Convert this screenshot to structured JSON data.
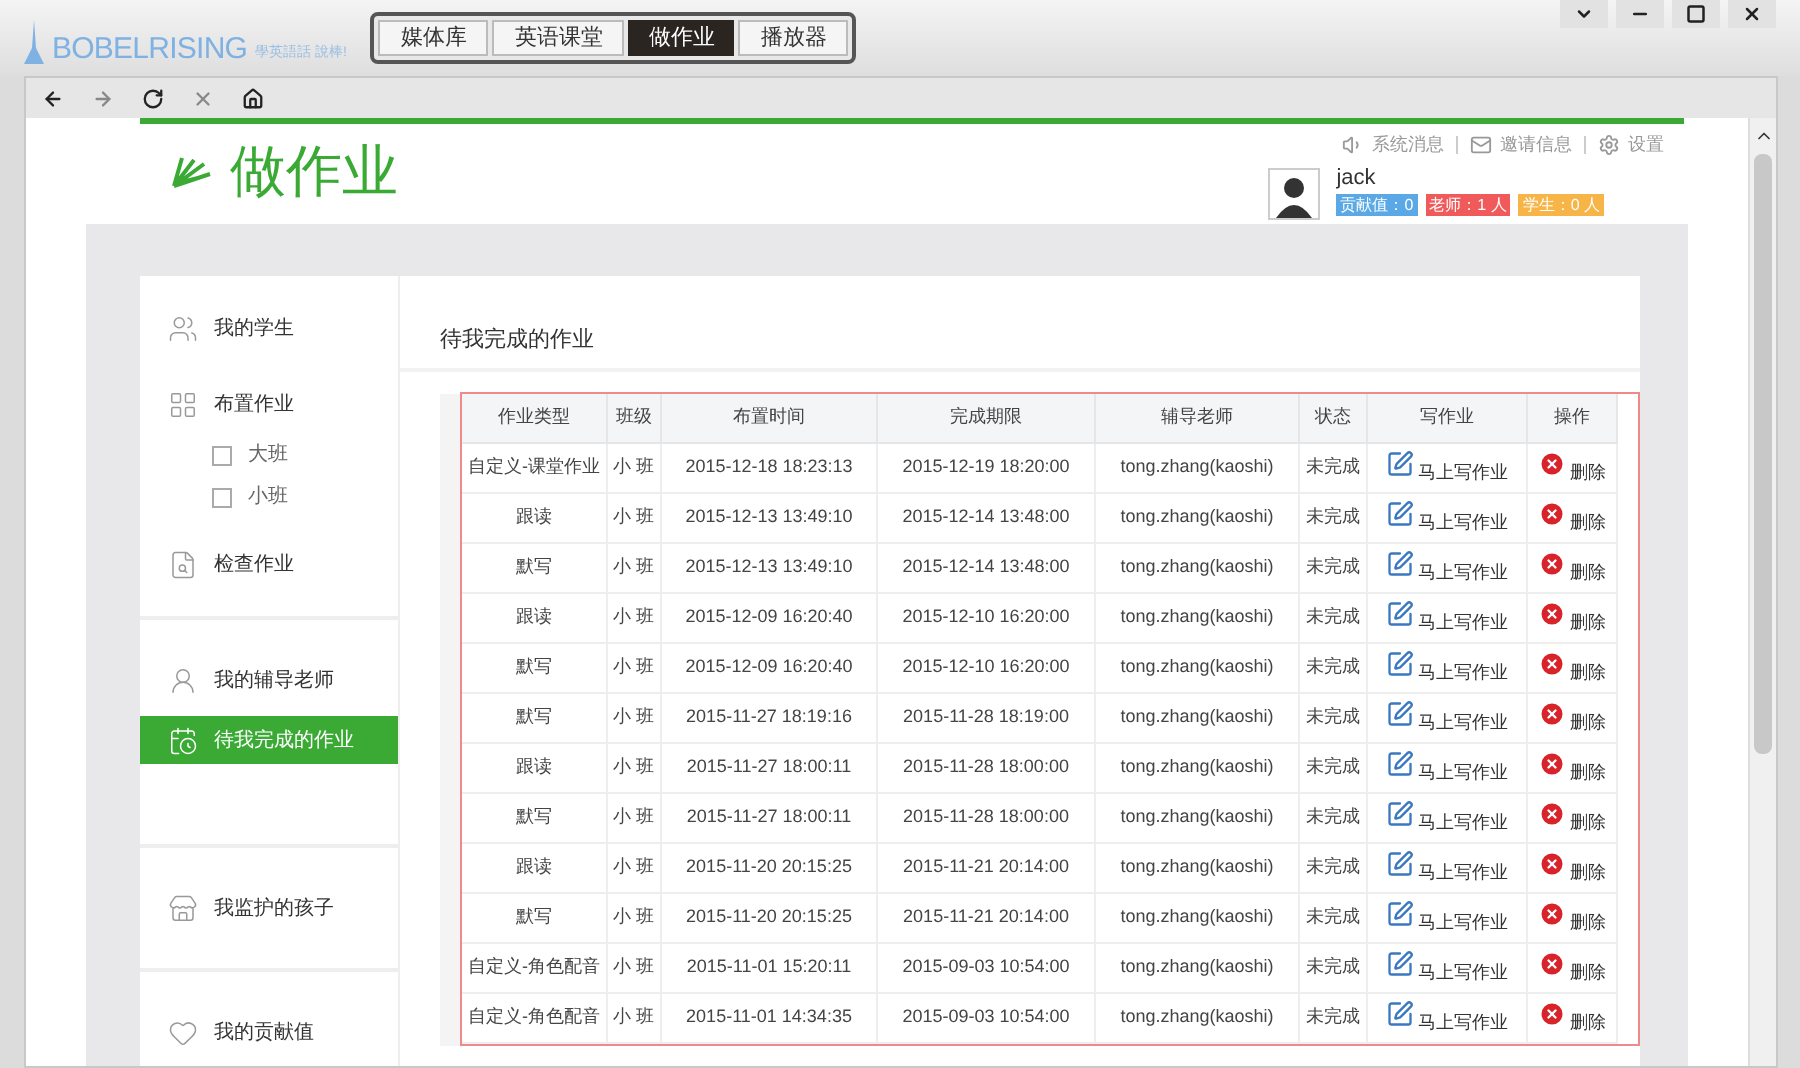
{
  "app": {
    "logo": "BOBELRISING",
    "slogan": "學英語話 說棒!",
    "tabs": [
      {
        "label": "媒体库",
        "selected": false
      },
      {
        "label": "英语课堂",
        "selected": false
      },
      {
        "label": "做作业",
        "selected": true
      },
      {
        "label": "播放器",
        "selected": false
      }
    ]
  },
  "page_title": "做作业",
  "header_links": [
    {
      "kind": "sound",
      "label": "系统消息"
    },
    {
      "kind": "mail",
      "label": "邀请信息"
    },
    {
      "kind": "gear",
      "label": "设置"
    }
  ],
  "user": {
    "name": "jack",
    "badges": [
      {
        "label": "贡献值：0",
        "color": "#5aa9e6"
      },
      {
        "label": "老师：1 人",
        "color": "#f05a5a"
      },
      {
        "label": "学生：0 人",
        "color": "#f7b548"
      }
    ]
  },
  "sidebar": [
    [
      {
        "kind": "users",
        "label": "我的学生",
        "selected": false
      },
      {
        "kind": "grid",
        "label": "布置作业",
        "selected": false,
        "children": [
          {
            "label": "大班",
            "selected": false
          },
          {
            "label": "小班",
            "selected": false
          }
        ]
      },
      {
        "kind": "doc",
        "label": "检查作业",
        "selected": false
      }
    ],
    [
      {
        "kind": "teacher",
        "label": "我的辅导老师",
        "selected": false
      },
      {
        "kind": "calendar",
        "label": "待我完成的作业",
        "selected": true
      }
    ],
    [
      {
        "kind": "shop",
        "label": "我监护的孩子",
        "selected": false
      }
    ],
    [
      {
        "kind": "heart",
        "label": "我的贡献值",
        "selected": false
      }
    ]
  ],
  "section_title": "待我完成的作业",
  "table": {
    "columns": [
      "作业类型",
      "班级",
      "布置时间",
      "完成期限",
      "辅导老师",
      "状态",
      "写作业",
      "操作"
    ],
    "rows": [
      [
        "自定义-课堂作业",
        "小 班",
        "2015-12-18 18:23:13",
        "2015-12-19 18:20:00",
        "tong.zhang(kaoshi)",
        "未完成",
        "马上写作业",
        "删除"
      ],
      [
        "跟读",
        "小 班",
        "2015-12-13 13:49:10",
        "2015-12-14 13:48:00",
        "tong.zhang(kaoshi)",
        "未完成",
        "马上写作业",
        "删除"
      ],
      [
        "默写",
        "小 班",
        "2015-12-13 13:49:10",
        "2015-12-14 13:48:00",
        "tong.zhang(kaoshi)",
        "未完成",
        "马上写作业",
        "删除"
      ],
      [
        "跟读",
        "小 班",
        "2015-12-09 16:20:40",
        "2015-12-10 16:20:00",
        "tong.zhang(kaoshi)",
        "未完成",
        "马上写作业",
        "删除"
      ],
      [
        "默写",
        "小 班",
        "2015-12-09 16:20:40",
        "2015-12-10 16:20:00",
        "tong.zhang(kaoshi)",
        "未完成",
        "马上写作业",
        "删除"
      ],
      [
        "默写",
        "小 班",
        "2015-11-27 18:19:16",
        "2015-11-28 18:19:00",
        "tong.zhang(kaoshi)",
        "未完成",
        "马上写作业",
        "删除"
      ],
      [
        "跟读",
        "小 班",
        "2015-11-27 18:00:11",
        "2015-11-28 18:00:00",
        "tong.zhang(kaoshi)",
        "未完成",
        "马上写作业",
        "删除"
      ],
      [
        "默写",
        "小 班",
        "2015-11-27 18:00:11",
        "2015-11-28 18:00:00",
        "tong.zhang(kaoshi)",
        "未完成",
        "马上写作业",
        "删除"
      ],
      [
        "跟读",
        "小 班",
        "2015-11-20 20:15:25",
        "2015-11-21 20:14:00",
        "tong.zhang(kaoshi)",
        "未完成",
        "马上写作业",
        "删除"
      ],
      [
        "默写",
        "小 班",
        "2015-11-20 20:15:25",
        "2015-11-21 20:14:00",
        "tong.zhang(kaoshi)",
        "未完成",
        "马上写作业",
        "删除"
      ],
      [
        "自定义-角色配音",
        "小 班",
        "2015-11-01 15:20:11",
        "2015-09-03 10:54:00",
        "tong.zhang(kaoshi)",
        "未完成",
        "马上写作业",
        "删除"
      ],
      [
        "自定义-角色配音",
        "小 班",
        "2015-11-01 14:34:35",
        "2015-09-03 10:54:00",
        "tong.zhang(kaoshi)",
        "未完成",
        "马上写作业",
        "删除"
      ]
    ]
  }
}
